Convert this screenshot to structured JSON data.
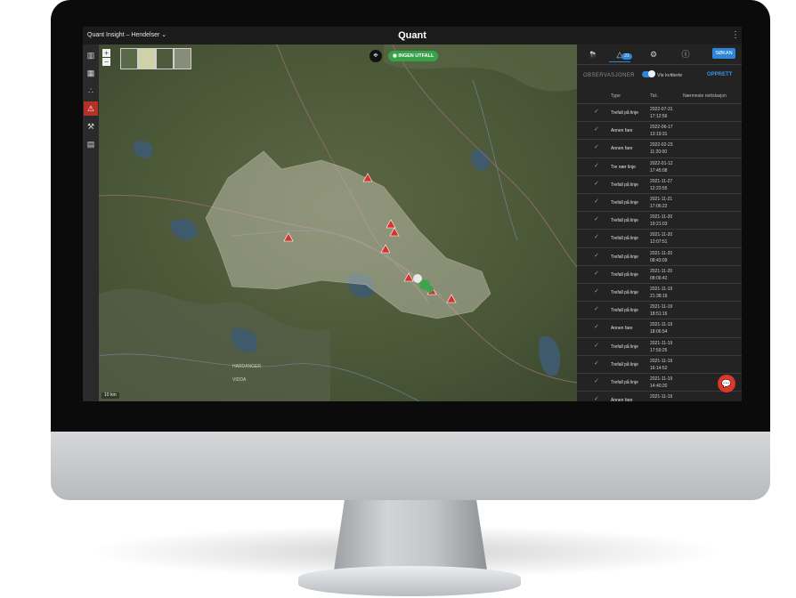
{
  "app": {
    "menu_label": "Quant Insight – Hendelser",
    "menu_chevron": "⌄",
    "title": "Quant",
    "more_icon": "⋮"
  },
  "map": {
    "zoom_in": "+",
    "zoom_out": "−",
    "status_pill": "INGEN UTFALL",
    "scale": "10 km",
    "place_labels": [
      "HARDANGER",
      "VIDDA"
    ]
  },
  "panel": {
    "tab_badge": "21",
    "search_button": "SØKAN",
    "section_label": "OBSERVASJONER",
    "toggle_label": "Vis kvitterte",
    "create_button": "OPPRETT",
    "columns": {
      "type": "Type",
      "time": "Tid",
      "station": "Nærmeste nettstasjon"
    },
    "rows": [
      {
        "type": "Trefall på linje",
        "date": "2022-07-31",
        "time": "17:12:56",
        "level": "red"
      },
      {
        "type": "Annen fare",
        "date": "2022-06-17",
        "time": "13:19:31",
        "level": "red"
      },
      {
        "type": "Annen fare",
        "date": "2022-02-23",
        "time": "11:20:00",
        "level": "red"
      },
      {
        "type": "Tre nær linje",
        "date": "2022-01-12",
        "time": "17:45:08",
        "level": "yellow"
      },
      {
        "type": "Trefall på linje",
        "date": "2021-11-27",
        "time": "12:23:55",
        "level": "red"
      },
      {
        "type": "Trefall på linje",
        "date": "2021-11-21",
        "time": "17:06:22",
        "level": "red"
      },
      {
        "type": "Trefall på linje",
        "date": "2021-11-20",
        "time": "19:21:03",
        "level": "red"
      },
      {
        "type": "Trefall på linje",
        "date": "2021-11-20",
        "time": "12:07:51",
        "level": "red"
      },
      {
        "type": "Trefall på linje",
        "date": "2021-11-20",
        "time": "08:43:09",
        "level": "red"
      },
      {
        "type": "Trefall på linje",
        "date": "2021-11-20",
        "time": "08:06:42",
        "level": "red"
      },
      {
        "type": "Trefall på linje",
        "date": "2021-11-19",
        "time": "21:38:19",
        "level": "red"
      },
      {
        "type": "Trefall på linje",
        "date": "2021-11-19",
        "time": "18:51:16",
        "level": "red"
      },
      {
        "type": "Annen fare",
        "date": "2021-11-19",
        "time": "18:06:54",
        "level": "red"
      },
      {
        "type": "Trefall på linje",
        "date": "2021-11-19",
        "time": "17:59:25",
        "level": "red"
      },
      {
        "type": "Trefall på linje",
        "date": "2021-11-19",
        "time": "16:14:52",
        "level": "red"
      },
      {
        "type": "Trefall på linje",
        "date": "2021-11-19",
        "time": "14:40:20",
        "level": "red"
      },
      {
        "type": "Annen fare",
        "date": "2021-11-19",
        "time": "",
        "level": "red"
      }
    ]
  },
  "colors": {
    "alert_red": "#d7332a",
    "warn_yellow": "#e2c23a",
    "accent_blue": "#2f86d6",
    "ok_green": "#38a24b"
  }
}
